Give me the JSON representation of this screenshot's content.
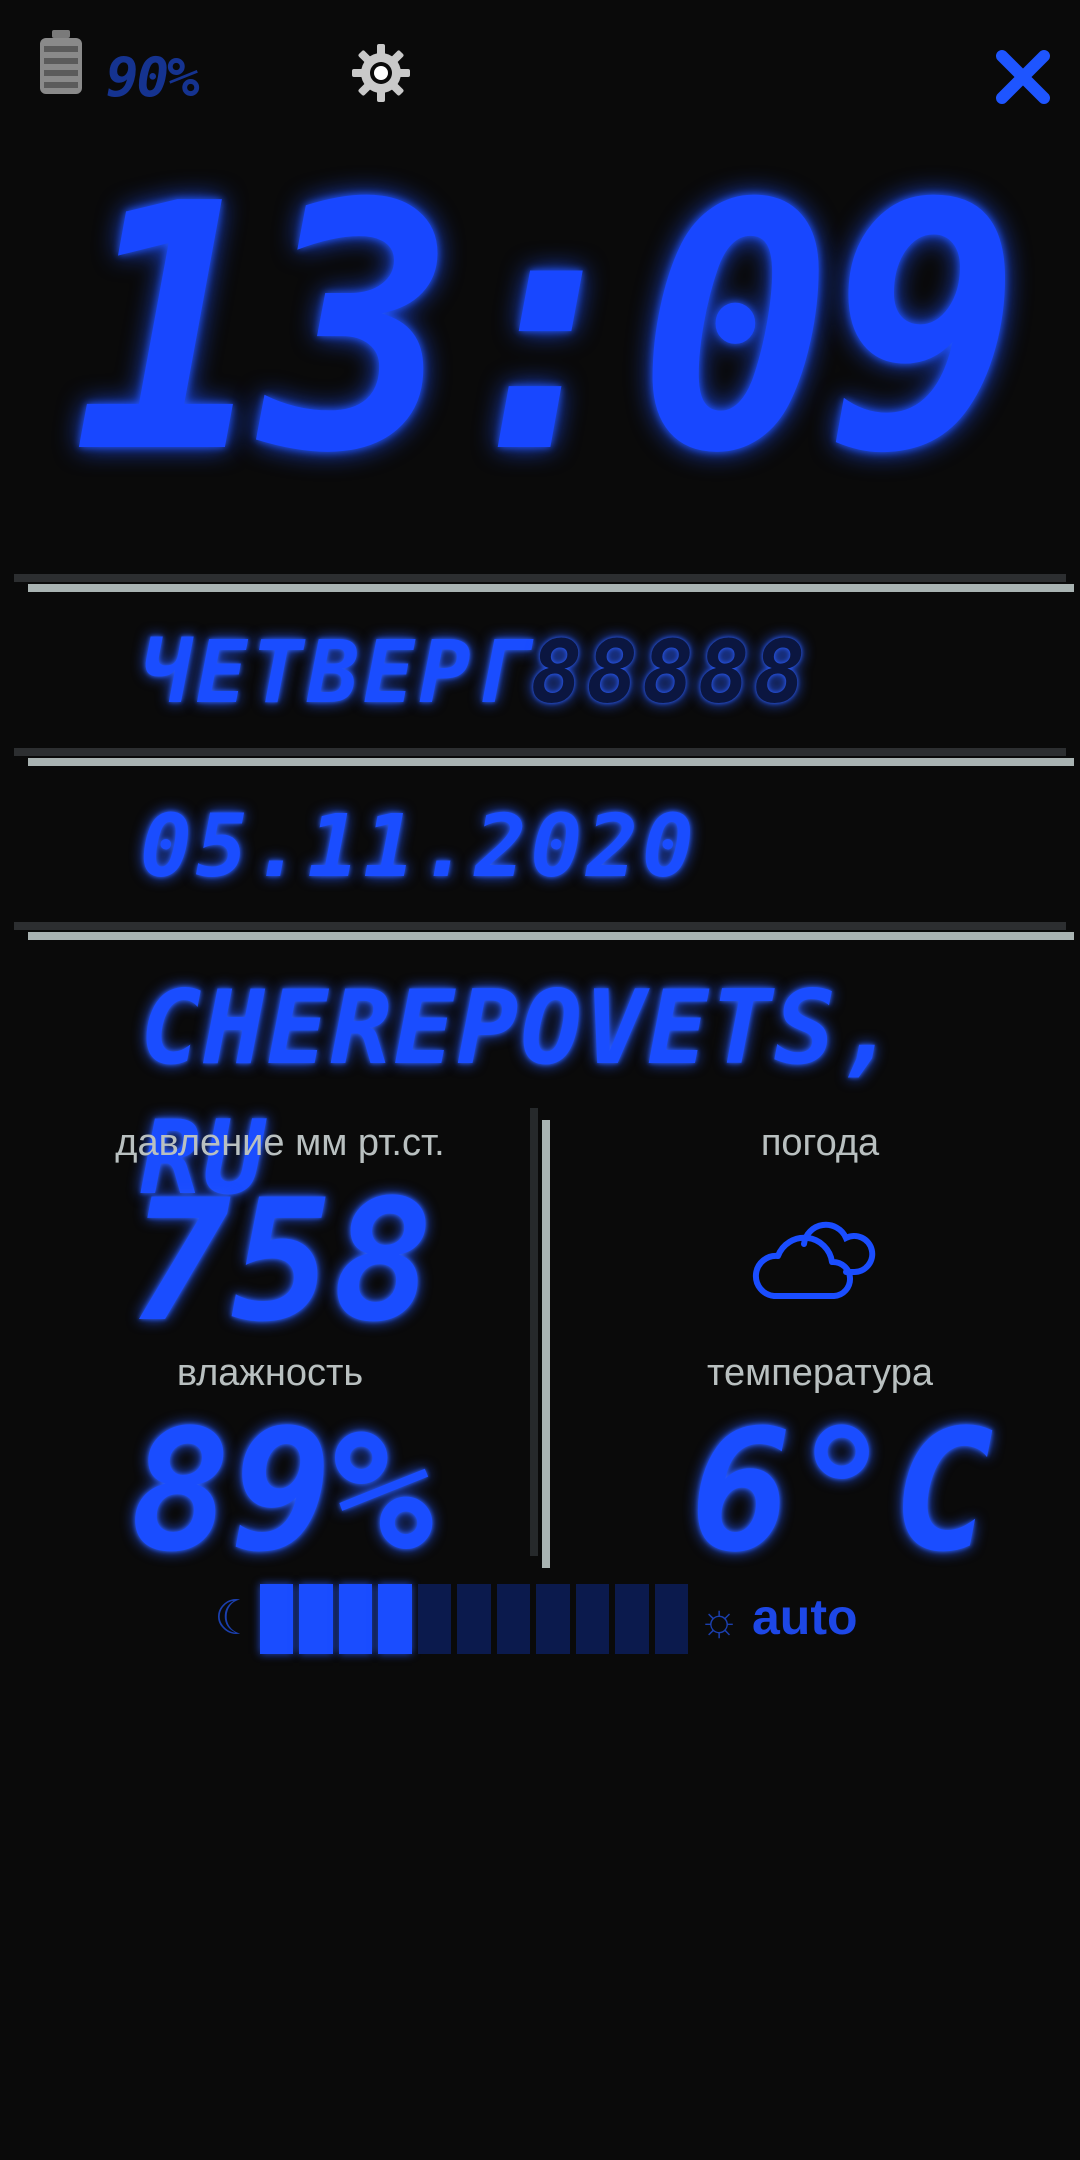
{
  "status": {
    "battery_text": "90%",
    "battery_icon": "battery-icon",
    "settings_icon": "gear-icon",
    "close_icon": "close-icon"
  },
  "clock": {
    "time": "13:09"
  },
  "lines": {
    "weekday": "ЧЕТВЕРГ",
    "date": "05.11.2020",
    "city": "CHEREPOVETS, RU"
  },
  "panels": {
    "pressure_label": "давление мм рт.ст.",
    "pressure_value": "758",
    "weather_label": "погода",
    "weather_icon": "cloud-icon",
    "humidity_label": "влажность",
    "humidity_value": "89%",
    "temperature_label": "температура",
    "temperature_value": "6°C"
  },
  "brightness": {
    "level": 0.36,
    "auto_label": "auto",
    "moon_icon": "moon-icon",
    "sun_icon": "sun-icon"
  },
  "colors": {
    "accent": "#1a4dff",
    "background": "#0a0a0a",
    "separator": "#a9b3b2"
  }
}
